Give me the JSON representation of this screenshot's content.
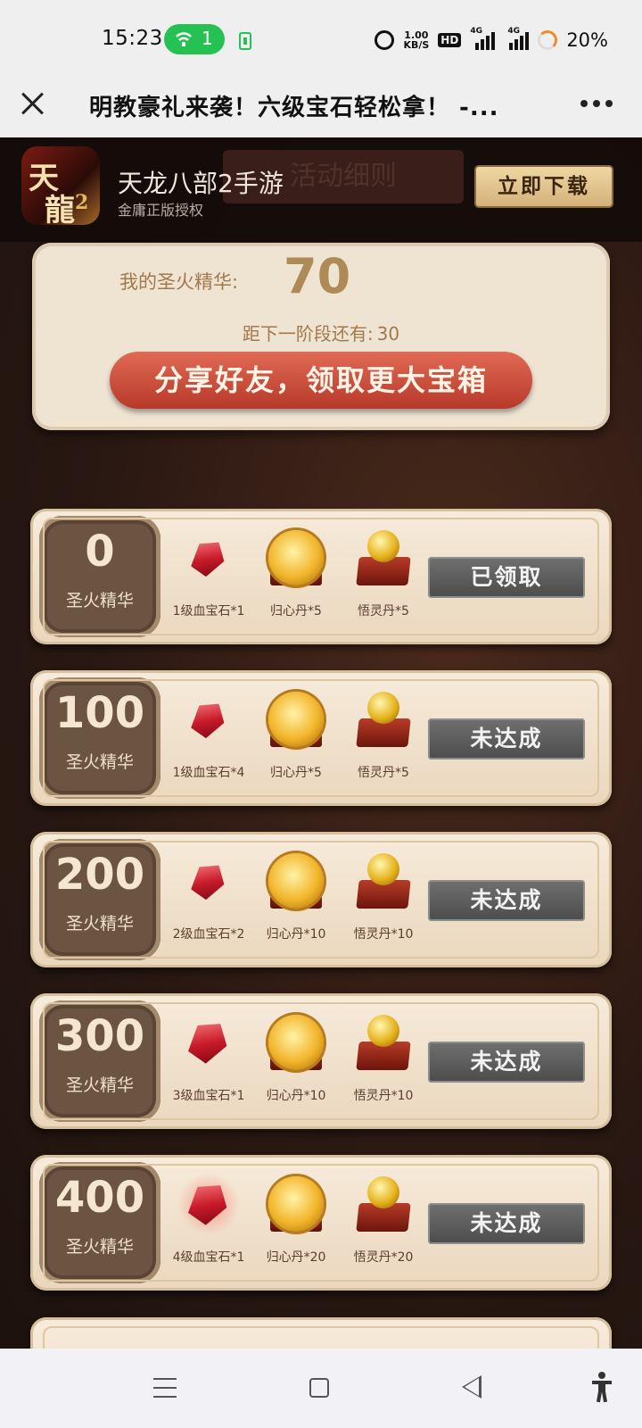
{
  "status_bar": {
    "time": "15:23",
    "hotspot_count": "1",
    "speed_value": "1.00",
    "speed_unit": "KB/S",
    "hd": "HD",
    "network_1": "4G",
    "network_2": "4G",
    "battery": "20%"
  },
  "title_bar": {
    "title": "明教豪礼来袭！六级宝石轻松拿！ -..."
  },
  "banner": {
    "background_text": "活动细则",
    "app_name": "天龙八部2手游",
    "app_subtitle": "金庸正版授权",
    "download_label": "立即下载",
    "icon_chars": [
      "天",
      "龍",
      "2"
    ]
  },
  "summary": {
    "label": "我的圣火精华:",
    "value": "70",
    "next_label": "距下一阶段还有:",
    "next_value": "30",
    "share_label": "分享好友，领取更大宝箱"
  },
  "tiers": [
    {
      "threshold": "0",
      "unit": "圣火精华",
      "rewards": [
        "1级血宝石*1",
        "归心丹*5",
        "悟灵丹*5"
      ],
      "status": "已领取"
    },
    {
      "threshold": "100",
      "unit": "圣火精华",
      "rewards": [
        "1级血宝石*4",
        "归心丹*5",
        "悟灵丹*5"
      ],
      "status": "未达成"
    },
    {
      "threshold": "200",
      "unit": "圣火精华",
      "rewards": [
        "2级血宝石*2",
        "归心丹*10",
        "悟灵丹*10"
      ],
      "status": "未达成"
    },
    {
      "threshold": "300",
      "unit": "圣火精华",
      "rewards": [
        "3级血宝石*1",
        "归心丹*10",
        "悟灵丹*10"
      ],
      "status": "未达成"
    },
    {
      "threshold": "400",
      "unit": "圣火精华",
      "rewards": [
        "4级血宝石*1",
        "归心丹*20",
        "悟灵丹*20"
      ],
      "status": "未达成"
    }
  ],
  "icons": {
    "close": "close-icon",
    "more": "more-icon",
    "reward_1": "blood-gem-icon",
    "reward_2": "guixin-pill-icon",
    "reward_3": "wuling-pill-icon"
  },
  "colors": {
    "share_button": "#c9493a",
    "status_button": "#5e5e5e",
    "badge": "#6b5442",
    "hotspot_pill": "#25c153"
  }
}
